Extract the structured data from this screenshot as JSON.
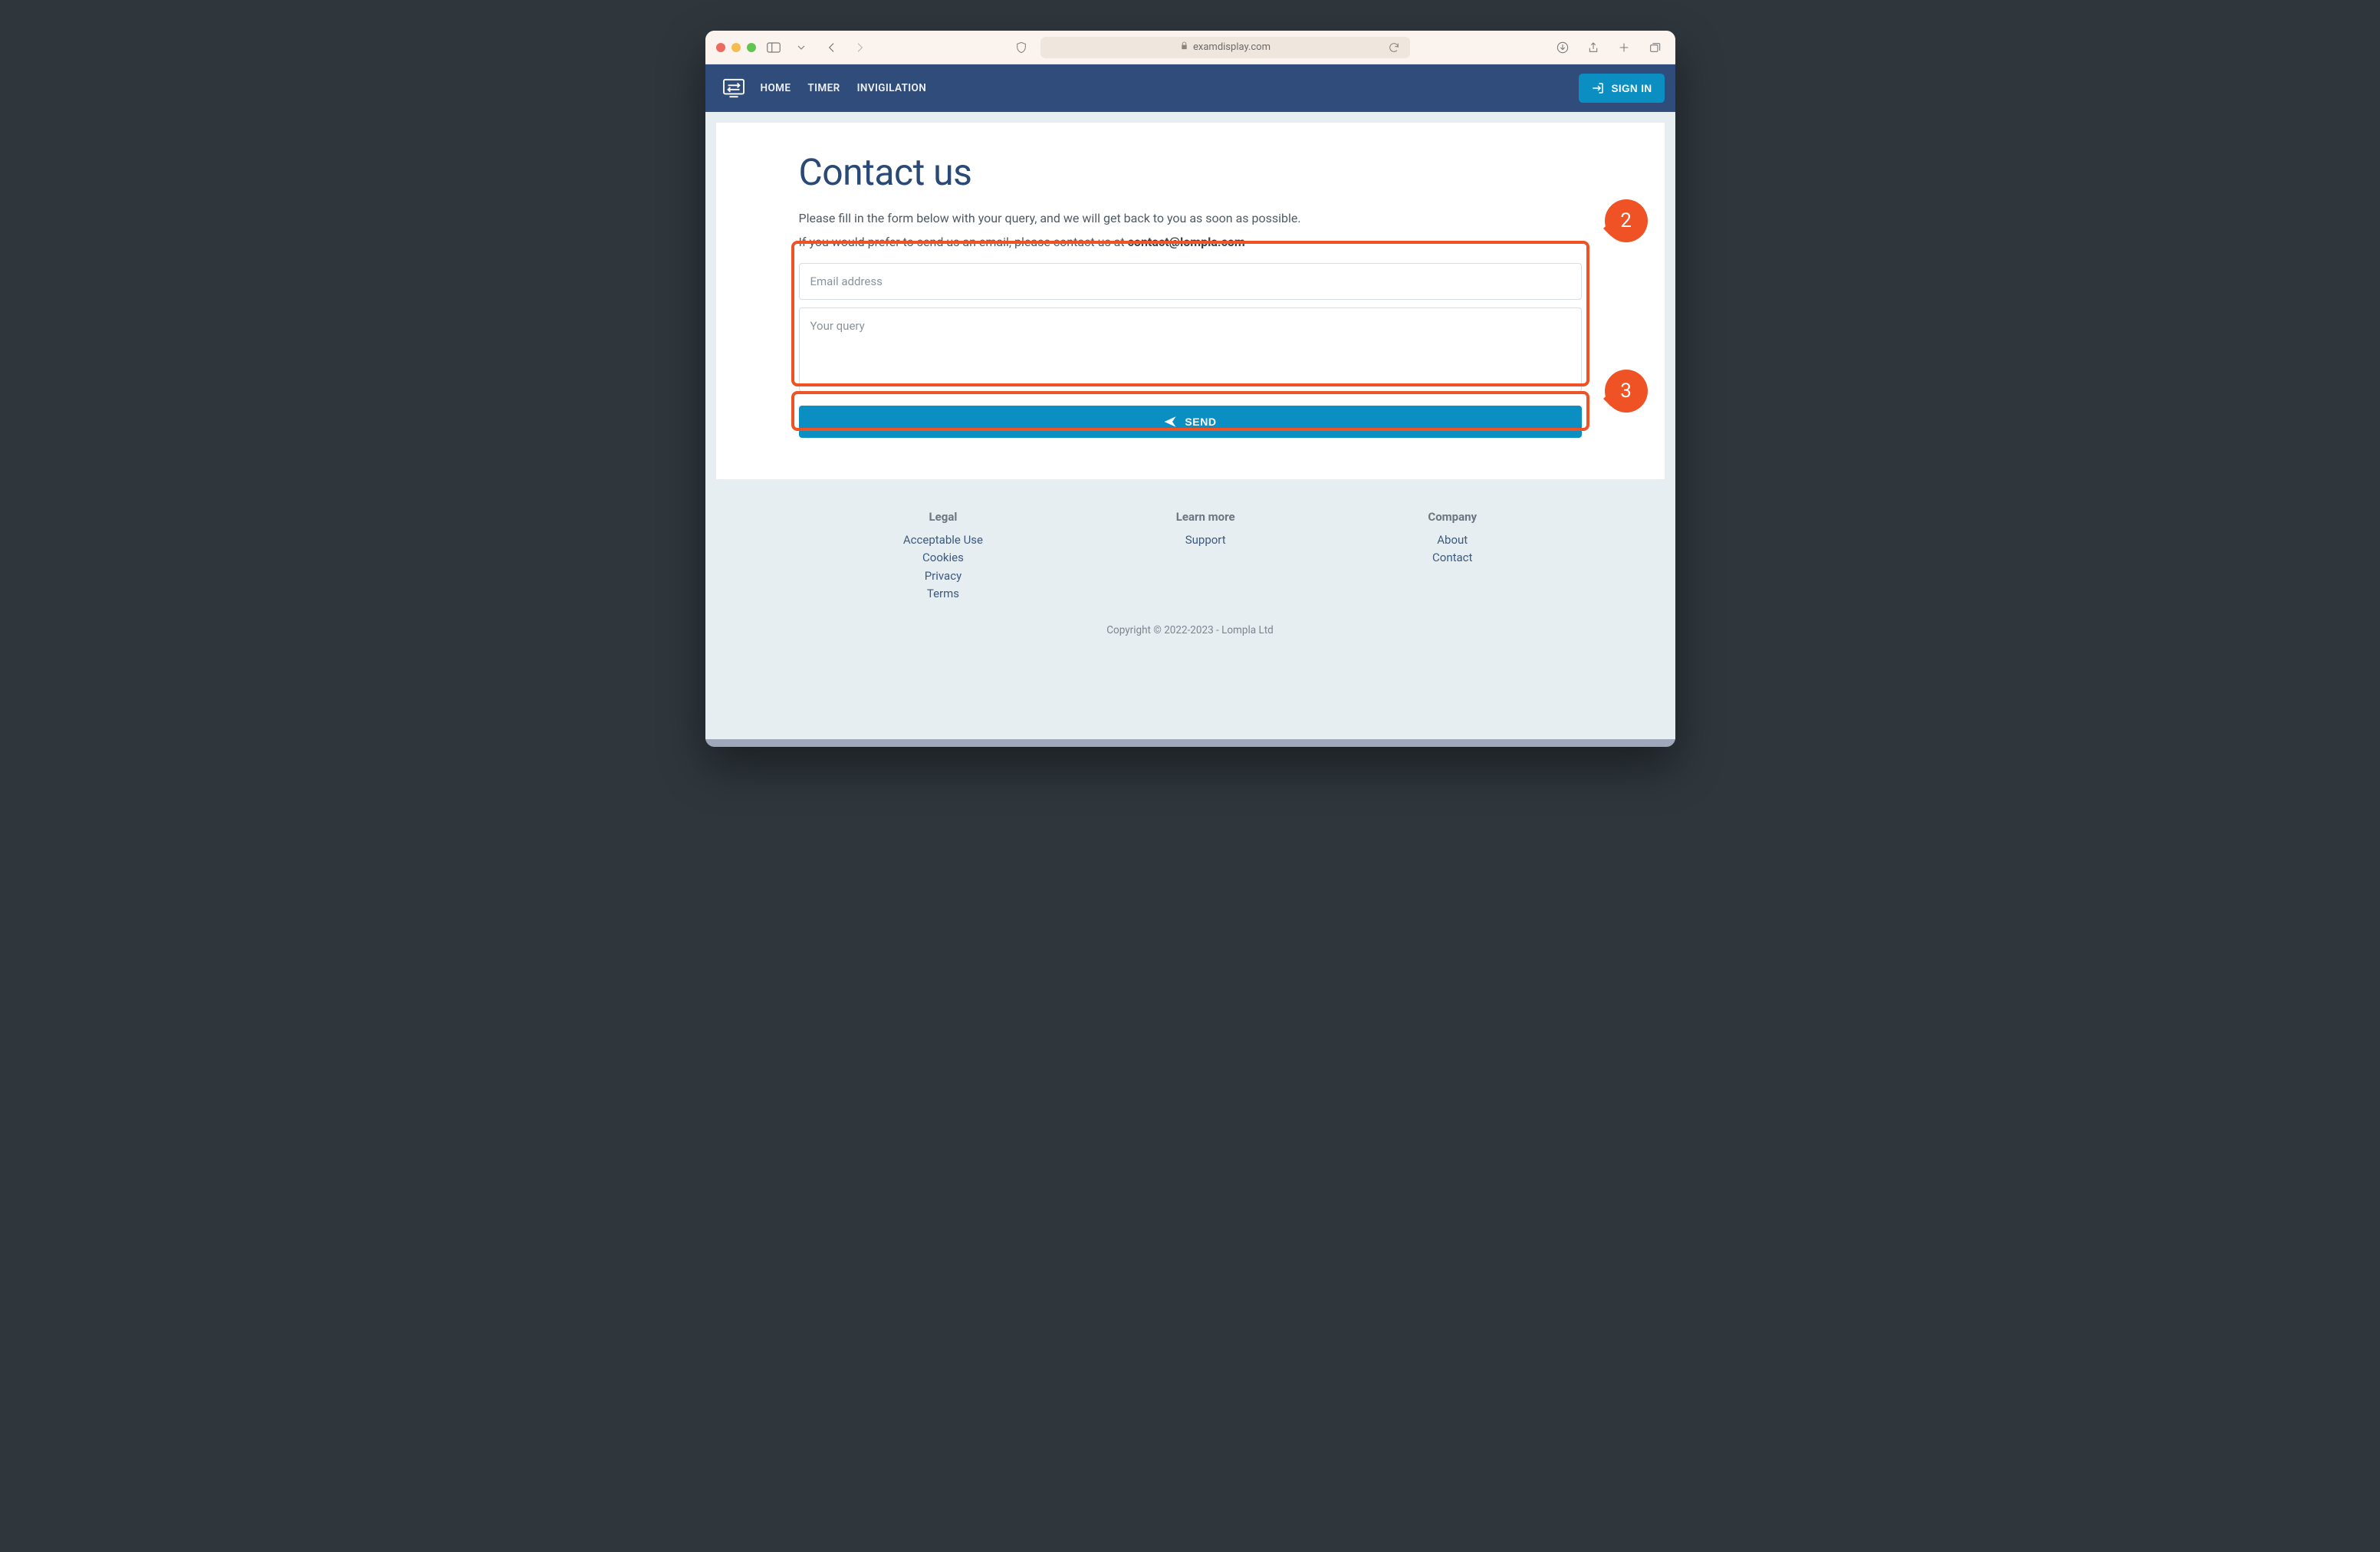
{
  "browser": {
    "url_host": "examdisplay.com"
  },
  "header": {
    "nav": [
      "HOME",
      "TIMER",
      "INVIGILATION"
    ],
    "signin_label": "SIGN IN"
  },
  "page": {
    "title": "Contact us",
    "intro_1": "Please fill in the form below with your query, and we will get back to you as soon as possible.",
    "intro_2_prefix": "If you would prefer to send us an email, please contact us at ",
    "contact_email": "contact@lompla.com",
    "email_placeholder": "Email address",
    "query_placeholder": "Your query",
    "send_label": "SEND"
  },
  "annotations": {
    "box_form": "2",
    "box_send": "3"
  },
  "footer": {
    "cols": [
      {
        "title": "Legal",
        "links": [
          "Acceptable Use",
          "Cookies",
          "Privacy",
          "Terms"
        ]
      },
      {
        "title": "Learn more",
        "links": [
          "Support"
        ]
      },
      {
        "title": "Company",
        "links": [
          "About",
          "Contact"
        ]
      }
    ],
    "copyright": "Copyright © 2022-2023 - Lompla Ltd"
  }
}
